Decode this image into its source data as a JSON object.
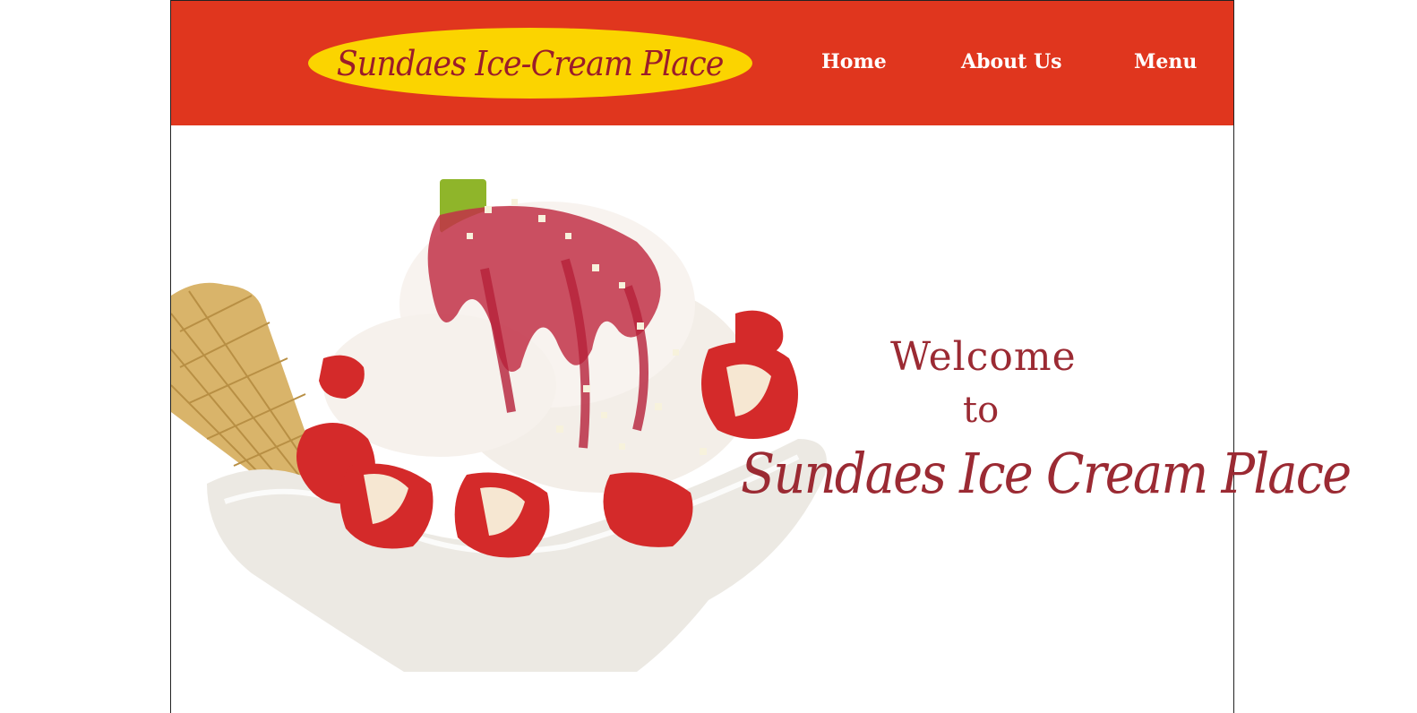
{
  "header": {
    "logo_text": "Sundaes Ice-Cream Place",
    "nav": [
      {
        "label": "Home"
      },
      {
        "label": "About Us"
      },
      {
        "label": "Menu"
      }
    ]
  },
  "hero": {
    "image_alt": "strawberry-sundae-image",
    "welcome": "Welcome",
    "to": "to",
    "brand": "Sundaes Ice Cream Place"
  },
  "colors": {
    "header_bg": "#e0361e",
    "logo_oval": "#fbd400",
    "brand_text": "#9b2a33",
    "nav_text": "#ffffff"
  }
}
